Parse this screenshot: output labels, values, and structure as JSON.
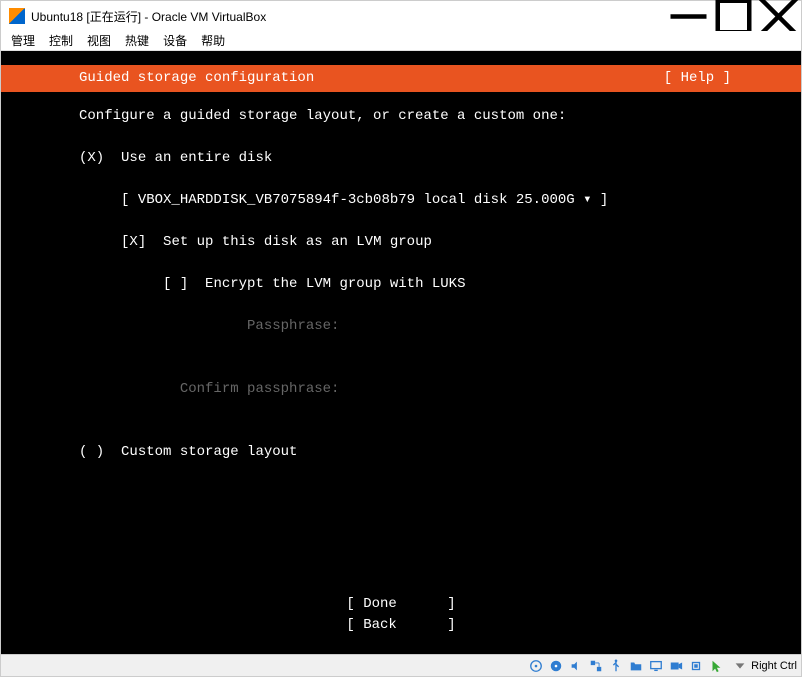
{
  "titlebar": {
    "title": "Ubuntu18 [正在运行] - Oracle VM VirtualBox"
  },
  "menubar": {
    "items": [
      "管理",
      "控制",
      "视图",
      "热键",
      "设备",
      "帮助"
    ]
  },
  "installer": {
    "header": "Guided storage configuration",
    "help": "[ Help ]",
    "prompt": "Configure a guided storage layout, or create a custom one:",
    "opt_entire_marker": "(X)",
    "opt_entire_label": "Use an entire disk",
    "disk_select": "[ VBOX_HARDDISK_VB7075894f-3cb08b79 local disk 25.000G ▾ ]",
    "lvm_marker": "[X]",
    "lvm_label": "Set up this disk as an LVM group",
    "luks_marker": "[ ]",
    "luks_label": "Encrypt the LVM group with LUKS",
    "passphrase_label": "Passphrase:",
    "confirm_label": "Confirm passphrase:",
    "opt_custom_marker": "( )",
    "opt_custom_label": "Custom storage layout",
    "btn_done": "[ Done      ]",
    "btn_back": "[ Back      ]"
  },
  "statusbar": {
    "hostkey": "Right Ctrl"
  },
  "colors": {
    "accent": "#e95420",
    "vb_icon_blue": "#2f7dd1"
  }
}
